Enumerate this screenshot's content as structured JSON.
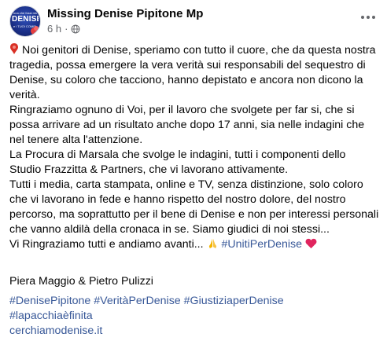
{
  "header": {
    "page_name": "Missing Denise Pipitone Mp",
    "time": "6 h",
    "avatar": {
      "top_line": "una che fossi mio",
      "big_text": "DENISE,",
      "sub_line": "e i TUOI COMPLICI, siete dalla"
    },
    "more_icon": "more-horizontal-icon",
    "privacy_icon": "globe-icon"
  },
  "post": {
    "p1": "Noi genitori di Denise, speriamo con tutto il cuore, che da questa nostra tragedia, possa emergere la vera verità sui responsabili del sequestro di Denise, su coloro che tacciono, hanno depistato e ancora non dicono la verità.",
    "p2": "Ringraziamo ognuno di Voi, per il lavoro che svolgete per far si, che si possa arrivare ad un risultato anche dopo 17 anni, sia nelle indagini che nel tenere alta l'attenzione.",
    "p3": "La Procura di Marsala che svolge le indagini, tutti i componenti dello Studio Frazzitta & Partners, che vi lavorano attivamente.",
    "p4": "Tutti i media, carta stampata, online e TV, senza distinzione, solo coloro che vi lavorano in fede e hanno rispetto del nostro dolore, del nostro percorso, ma soprattutto per il bene di Denise e non per interessi personali che vanno aldilà della cronaca in se. Siamo giudici di noi stessi...",
    "p5_text": "Vi Ringraziamo tutti e andiamo avanti...",
    "p5_hashtag": "#UnitiPerDenise",
    "signature": "Piera Maggio & Pietro Pulizzi",
    "hashtags": [
      "#DenisePipitone",
      "#VeritàPerDenise",
      "#GiustiziaperDenise",
      "#lapacchiaèfinita"
    ],
    "link": "cerchiamodenise.it"
  },
  "colors": {
    "link": "#385898",
    "meta": "#65676b",
    "text": "#050505",
    "heart": "#e0245e",
    "pin": "#d93025"
  }
}
